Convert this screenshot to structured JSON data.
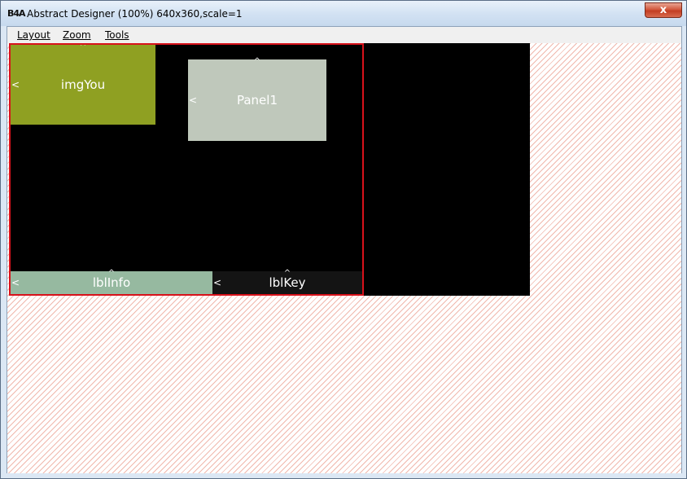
{
  "window": {
    "icon_text": "B4A",
    "title": "Abstract Designer (100%) 640x360,scale=1",
    "close_label": "x"
  },
  "menu": {
    "items": [
      {
        "label": "Layout"
      },
      {
        "label": "Zoom"
      },
      {
        "label": "Tools"
      }
    ]
  },
  "views": {
    "imgYou": {
      "label": "imgYou",
      "color": "#8fa022"
    },
    "panel1": {
      "label": "Panel1",
      "color": "#bfc8bb"
    },
    "lblInfo": {
      "label": "lblInfo",
      "color": "#96b9a0"
    },
    "lblKey": {
      "label": "lblKey",
      "color": "#141414"
    }
  },
  "colors": {
    "selection_border": "#d8121b",
    "device_background": "#000000",
    "hatch": "#f0b8ad"
  }
}
